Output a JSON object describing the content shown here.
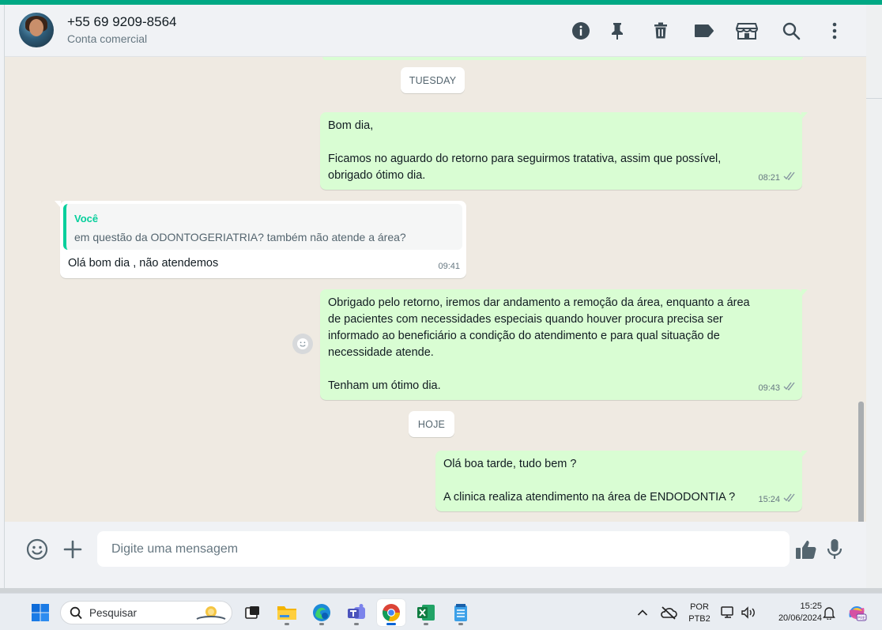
{
  "header": {
    "contact_name": "+55 69 9209-8564",
    "contact_subtitle": "Conta comercial",
    "icons": [
      "info-icon",
      "pin-icon",
      "delete-icon",
      "label-icon",
      "store-icon",
      "search-icon",
      "menu-icon"
    ]
  },
  "chat": {
    "date_tuesday": "TUESDAY",
    "date_today": "HOJE",
    "messages": [
      {
        "direction": "out",
        "text": "Bom dia,\n\nFicamos no aguardo do retorno para seguirmos tratativa, assim que possível,\nobrigado ótimo dia.",
        "time": "08:21"
      },
      {
        "direction": "in",
        "quote_author": "Você",
        "quote_text": "em questão da ODONTOGERIATRIA? também não atende a área?",
        "text": "Olá bom dia , não atendemos",
        "time": "09:41"
      },
      {
        "direction": "out",
        "text": "Obrigado pelo retorno, iremos dar andamento a remoção da área, enquanto a área\nde pacientes com necessidades especiais quando houver procura precisa ser\ninformado ao beneficiário a condição do atendimento e para qual situação de\nnecessidade atende.\n\nTenham um ótimo dia.",
        "time": "09:43"
      },
      {
        "direction": "out",
        "text": "Olá boa tarde, tudo bem ?\n\nA clinica realiza atendimento na área de ENDODONTIA ?",
        "time": "15:24"
      }
    ]
  },
  "composer": {
    "placeholder": "Digite uma mensagem"
  },
  "taskbar": {
    "search_label": "Pesquisar",
    "lang_top": "POR",
    "lang_bottom": "PTB2",
    "time": "15:25",
    "date": "20/06/2024"
  },
  "colors": {
    "accent": "#00a884",
    "outgoing_bubble": "#d9fdd3",
    "incoming_bubble": "#ffffff",
    "quote_author": "#06cf9c",
    "chat_background": "#efeae2"
  }
}
